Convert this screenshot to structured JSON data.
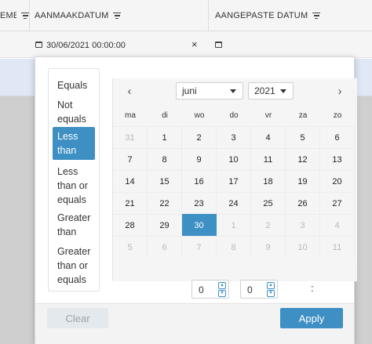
{
  "grid": {
    "columns": [
      {
        "label": "EMEN"
      },
      {
        "label": "AANMAAKDATUM"
      },
      {
        "label": "AANGEPASTE DATUM"
      }
    ],
    "filter": {
      "value": "30/06/2021 00:00:00",
      "clear_glyph": "×"
    }
  },
  "operators": [
    {
      "label": "Equals",
      "selected": false
    },
    {
      "label": "Not equals",
      "selected": false
    },
    {
      "label": "Less than",
      "selected": true
    },
    {
      "label": "Less than or equals",
      "selected": false
    },
    {
      "label": "Greater than",
      "selected": false
    },
    {
      "label": "Greater than or equals",
      "selected": false
    }
  ],
  "calendar": {
    "prev_glyph": "‹",
    "next_glyph": "›",
    "month": "juni",
    "year": "2021",
    "weekdays": [
      "ma",
      "di",
      "wo",
      "do",
      "vr",
      "za",
      "zo"
    ],
    "weeks": [
      [
        [
          "31",
          "out"
        ],
        [
          "1",
          ""
        ],
        [
          "2",
          ""
        ],
        [
          "3",
          ""
        ],
        [
          "4",
          ""
        ],
        [
          "5",
          ""
        ],
        [
          "6",
          ""
        ]
      ],
      [
        [
          "7",
          ""
        ],
        [
          "8",
          ""
        ],
        [
          "9",
          ""
        ],
        [
          "10",
          ""
        ],
        [
          "11",
          ""
        ],
        [
          "12",
          ""
        ],
        [
          "13",
          ""
        ]
      ],
      [
        [
          "14",
          ""
        ],
        [
          "15",
          ""
        ],
        [
          "16",
          ""
        ],
        [
          "17",
          ""
        ],
        [
          "18",
          ""
        ],
        [
          "19",
          ""
        ],
        [
          "20",
          ""
        ]
      ],
      [
        [
          "21",
          ""
        ],
        [
          "22",
          ""
        ],
        [
          "23",
          ""
        ],
        [
          "24",
          ""
        ],
        [
          "25",
          ""
        ],
        [
          "26",
          ""
        ],
        [
          "27",
          ""
        ]
      ],
      [
        [
          "28",
          ""
        ],
        [
          "29",
          ""
        ],
        [
          "30",
          "sel"
        ],
        [
          "1",
          "out"
        ],
        [
          "2",
          "out"
        ],
        [
          "3",
          "out"
        ],
        [
          "4",
          "out"
        ]
      ],
      [
        [
          "5",
          "out"
        ],
        [
          "6",
          "out"
        ],
        [
          "7",
          "out"
        ],
        [
          "8",
          "out"
        ],
        [
          "9",
          "out"
        ],
        [
          "10",
          "out"
        ],
        [
          "11",
          "out"
        ]
      ]
    ],
    "time": {
      "hours": "0",
      "separator": ":",
      "minutes": "0"
    }
  },
  "footer": {
    "clear_label": "Clear",
    "apply_label": "Apply"
  },
  "colors": {
    "accent": "#3d8fc4",
    "row_highlight": "#dfe8f4"
  }
}
